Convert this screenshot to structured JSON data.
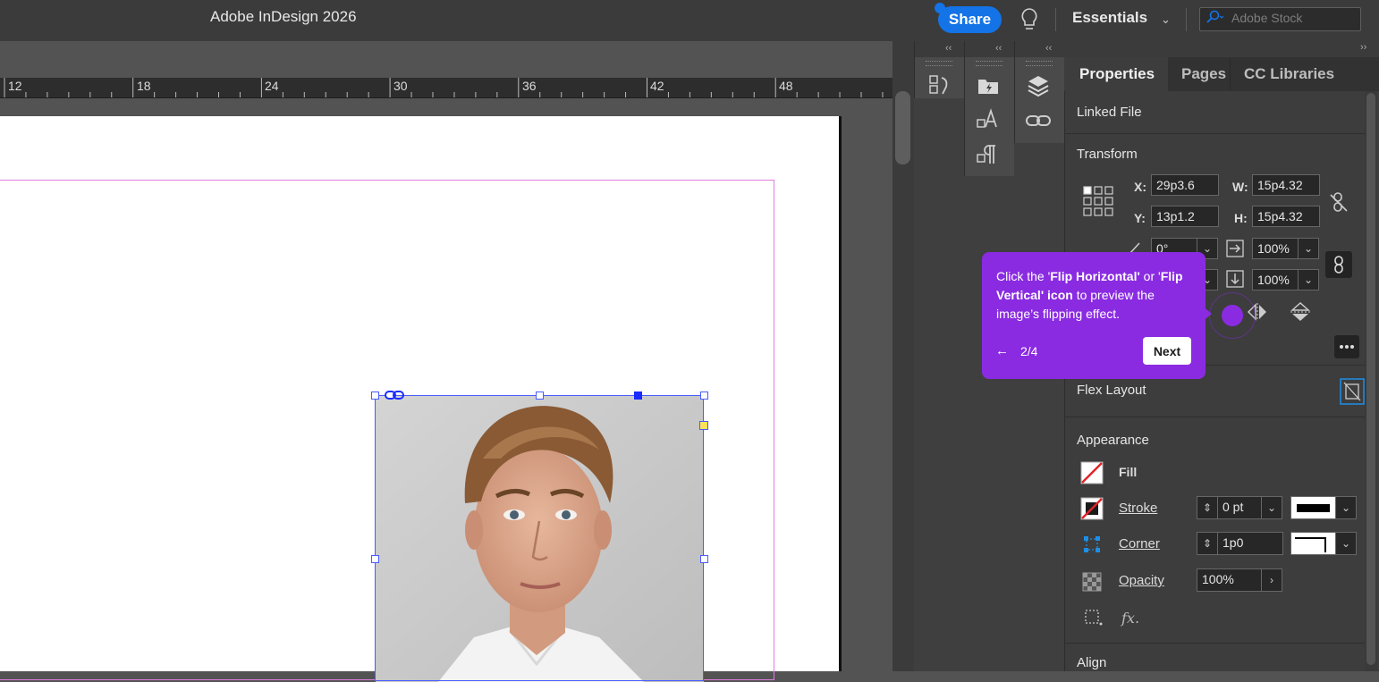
{
  "app": {
    "title": "Adobe InDesign 2026"
  },
  "topbar": {
    "share_label": "Share",
    "workspace_label": "Essentials",
    "stock_placeholder": "Adobe Stock"
  },
  "ruler": {
    "labels": [
      "12",
      "18",
      "24",
      "30",
      "36",
      "42",
      "48"
    ]
  },
  "panel_tabs": {
    "properties": "Properties",
    "pages": "Pages",
    "libraries": "CC Libraries"
  },
  "properties": {
    "linked_file": "Linked File",
    "transform": {
      "title": "Transform",
      "x_label": "X:",
      "x_value": "29p3.6",
      "y_label": "Y:",
      "y_value": "13p1.2",
      "w_label": "W:",
      "w_value": "15p4.32",
      "h_label": "H:",
      "h_value": "15p4.32",
      "rotate_value": "0°",
      "scale_x_value": "100%",
      "scale_y_value": "100%"
    },
    "flex_layout": "Flex Layout",
    "appearance": {
      "title": "Appearance",
      "fill_label": "Fill",
      "stroke_label": "Stroke",
      "stroke_value": "0 pt",
      "corner_label": "Corner",
      "corner_value": "1p0",
      "opacity_label": "Opacity",
      "opacity_value": "100%",
      "fx_label": "fx."
    },
    "align": "Align"
  },
  "coachmark": {
    "text_1": "Click the '",
    "bold_1": "Flip Horizontal'",
    "text_2": " or '",
    "bold_2": "Flip Vertical' icon",
    "text_3": " to preview the image’s flipping effect.",
    "step": "2/4",
    "next_label": "Next"
  },
  "colors": {
    "accent": "#1473e6",
    "coachmark": "#8a2be2",
    "selection": "#4a5cff"
  }
}
